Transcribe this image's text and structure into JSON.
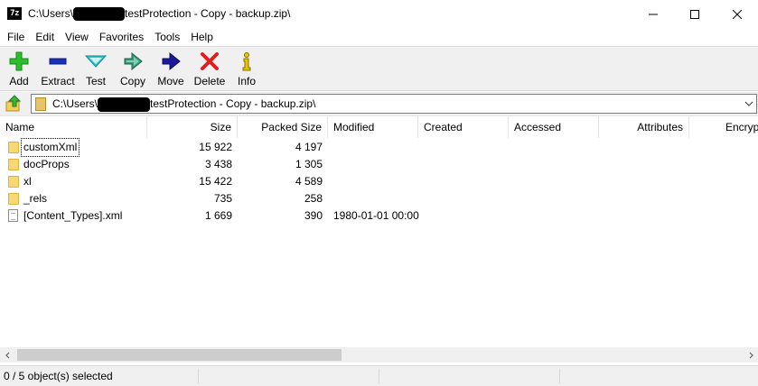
{
  "window": {
    "icon_text": "7z",
    "title_prefix": "C:\\Users\\",
    "title_suffix": "testProtection - Copy - backup.zip\\"
  },
  "menu": [
    "File",
    "Edit",
    "View",
    "Favorites",
    "Tools",
    "Help"
  ],
  "toolbar": [
    {
      "label": "Add",
      "icon": "add-icon",
      "color": "#2ebd2e"
    },
    {
      "label": "Extract",
      "icon": "extract-icon",
      "color": "#1a2fb8"
    },
    {
      "label": "Test",
      "icon": "test-icon",
      "color": "#2ec6c6"
    },
    {
      "label": "Copy",
      "icon": "copy-icon",
      "color": "#3a9a7a"
    },
    {
      "label": "Move",
      "icon": "move-icon",
      "color": "#1a1a9a"
    },
    {
      "label": "Delete",
      "icon": "delete-icon",
      "color": "#e01e1e"
    },
    {
      "label": "Info",
      "icon": "info-icon",
      "color": "#e8c400"
    }
  ],
  "address": {
    "prefix": "C:\\Users\\",
    "suffix": "testProtection - Copy - backup.zip\\"
  },
  "columns": [
    "Name",
    "Size",
    "Packed Size",
    "Modified",
    "Created",
    "Accessed",
    "Attributes",
    "Encryp"
  ],
  "rows": [
    {
      "name": "customXml",
      "type": "folder",
      "size": "15 922",
      "packed": "4 197",
      "modified": ""
    },
    {
      "name": "docProps",
      "type": "folder",
      "size": "3 438",
      "packed": "1 305",
      "modified": ""
    },
    {
      "name": "xl",
      "type": "folder",
      "size": "15 422",
      "packed": "4 589",
      "modified": ""
    },
    {
      "name": "_rels",
      "type": "folder",
      "size": "735",
      "packed": "258",
      "modified": ""
    },
    {
      "name": "[Content_Types].xml",
      "type": "file",
      "size": "1 669",
      "packed": "390",
      "modified": "1980-01-01 00:00"
    }
  ],
  "status": {
    "selection": "0 / 5 object(s) selected"
  }
}
